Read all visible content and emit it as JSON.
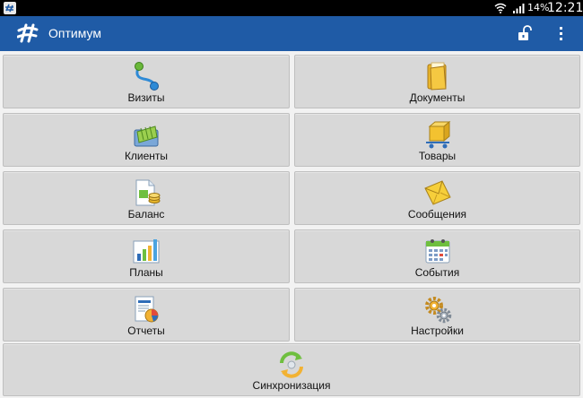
{
  "status_bar": {
    "battery_percent": "14%",
    "time": "12:21",
    "icons": [
      "app-notification-icon",
      "wifi-icon",
      "signal-icon",
      "battery-icon"
    ]
  },
  "action_bar": {
    "title": "Оптимум",
    "color": "#1f5ba6",
    "icons": [
      "app-logo-icon",
      "lock-icon",
      "overflow-menu-icon"
    ]
  },
  "menu": {
    "tiles": [
      {
        "label": "Визиты",
        "icon": "visits-icon"
      },
      {
        "label": "Документы",
        "icon": "folder-icon"
      },
      {
        "label": "Клиенты",
        "icon": "clients-icon"
      },
      {
        "label": "Товары",
        "icon": "goods-cart-icon"
      },
      {
        "label": "Баланс",
        "icon": "balance-icon"
      },
      {
        "label": "Сообщения",
        "icon": "envelope-icon"
      },
      {
        "label": "Планы",
        "icon": "chart-icon"
      },
      {
        "label": "События",
        "icon": "calendar-icon"
      },
      {
        "label": "Отчеты",
        "icon": "reports-icon"
      },
      {
        "label": "Настройки",
        "icon": "gears-icon"
      },
      {
        "label": "Синхронизация",
        "icon": "sync-icon"
      }
    ]
  }
}
